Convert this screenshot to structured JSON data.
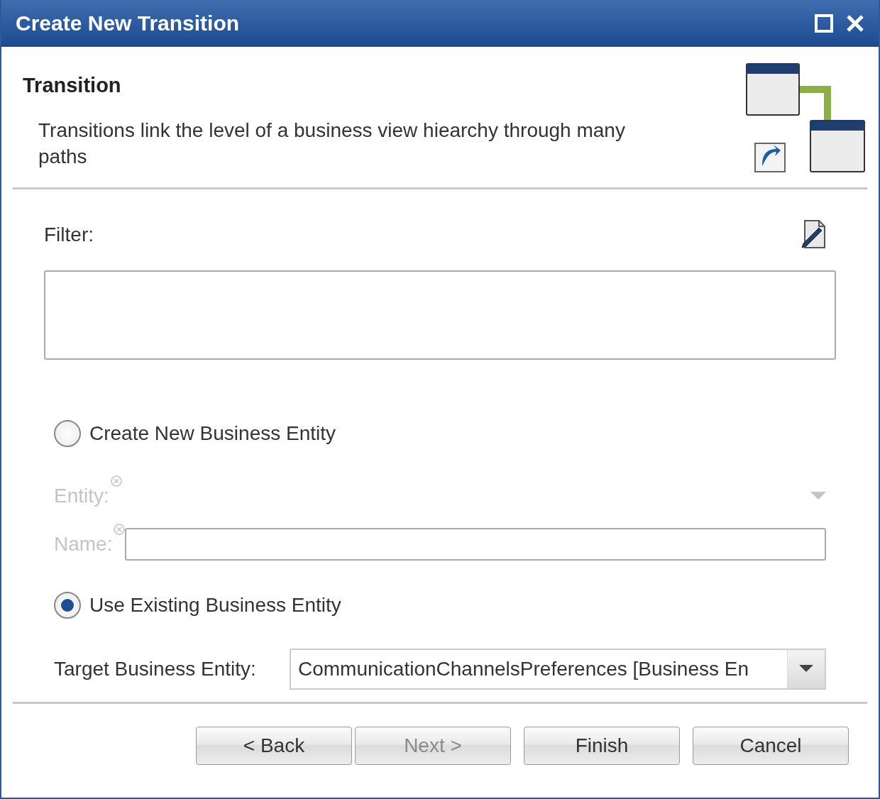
{
  "window": {
    "title": "Create New Transition"
  },
  "header": {
    "title": "Transition",
    "description": "Transitions link the level of a business view hiearchy through many paths"
  },
  "filter": {
    "label": "Filter:"
  },
  "options": [
    {
      "label": "Create New Business Entity",
      "selected": false
    },
    {
      "label": "Use Existing Business Entity",
      "selected": true
    }
  ],
  "new_entity": {
    "disabled": true,
    "fields": [
      {
        "kind": "dropdown",
        "label": "Entity:"
      },
      {
        "kind": "text",
        "label": "Name:"
      }
    ]
  },
  "target": {
    "label": "Target Business Entity:",
    "value": "CommunicationChannelsPreferences [Business En"
  },
  "buttons": [
    {
      "label": "< Back",
      "disabled": false
    },
    {
      "label": "Next >",
      "disabled": true
    },
    {
      "label": "Finish",
      "disabled": false
    },
    {
      "label": "Cancel",
      "disabled": false
    }
  ]
}
